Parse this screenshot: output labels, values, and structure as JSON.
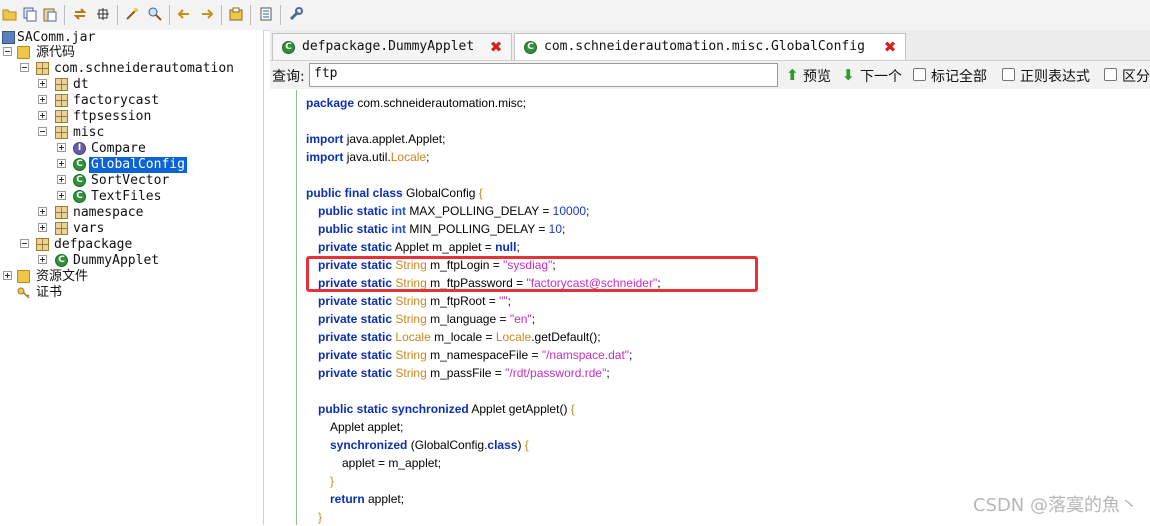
{
  "toolbar": {
    "icons": [
      "open-folder-icon",
      "copy-icon",
      "paste-icon",
      "sync-icon",
      "grid-icon",
      "wand-icon",
      "zoom-icon",
      "back-icon",
      "forward-icon",
      "save-icon",
      "list-icon",
      "wrench-icon"
    ]
  },
  "tree": {
    "root": "SAComm.jar",
    "source": "源代码",
    "pkg_com": "com.schneiderautomation",
    "dt": "dt",
    "factorycast": "factorycast",
    "ftpsession": "ftpsession",
    "misc": "misc",
    "compare": "Compare",
    "globalconfig": "GlobalConfig",
    "sortvector": "SortVector",
    "textfiles": "TextFiles",
    "namespace": "namespace",
    "vars": "vars",
    "defpackage": "defpackage",
    "dummyapplet": "DummyApplet",
    "resources": "资源文件",
    "cert": "证书"
  },
  "tabs": [
    {
      "label": "defpackage.DummyApplet"
    },
    {
      "label": "com.schneiderautomation.misc.GlobalConfig"
    }
  ],
  "search": {
    "label": "查询:",
    "value": "ftp",
    "prev": "预览",
    "next": "下一个",
    "mark_all": "标记全部",
    "regex": "正则表达式",
    "case": "区分"
  },
  "code": {
    "l1": "com.schneiderautomation.misc;",
    "l3": "java.applet.Applet;",
    "l4a": "java.util.",
    "l4b": "Locale",
    "l4c": ";",
    "class_name": "GlobalConfig",
    "max_name": "MAX_POLLING_DELAY = ",
    "max_val": "10000",
    "min_name": "MIN_POLLING_DELAY = ",
    "min_val": "10",
    "applet_decl": "Applet m_applet = ",
    "null": "null",
    "login_name": " m_ftpLogin = ",
    "login_val": "\"sysdiag\"",
    "pass_name": " m_ftpPassword = ",
    "pass_val": "\"factorycast@schneider\"",
    "root_name": " m_ftpRoot = ",
    "root_val": "\"\"",
    "lang_name": " m_language = ",
    "lang_val": "\"en\"",
    "locale_name": " m_locale = ",
    "locale_call": ".getDefault();",
    "ns_name": " m_namespaceFile = ",
    "ns_val": "\"/namspace.dat\"",
    "pf_name": " m_passFile = ",
    "pf_val": "\"/rdt/password.rde\"",
    "get_applet": "Applet getApplet() ",
    "applet_local": "Applet applet;",
    "sync_open": "(GlobalConfig.",
    "sync_close": ") ",
    "assign": "applet = m_applet;",
    "ret": " applet;"
  },
  "watermark": "CSDN @落寞的魚丶"
}
